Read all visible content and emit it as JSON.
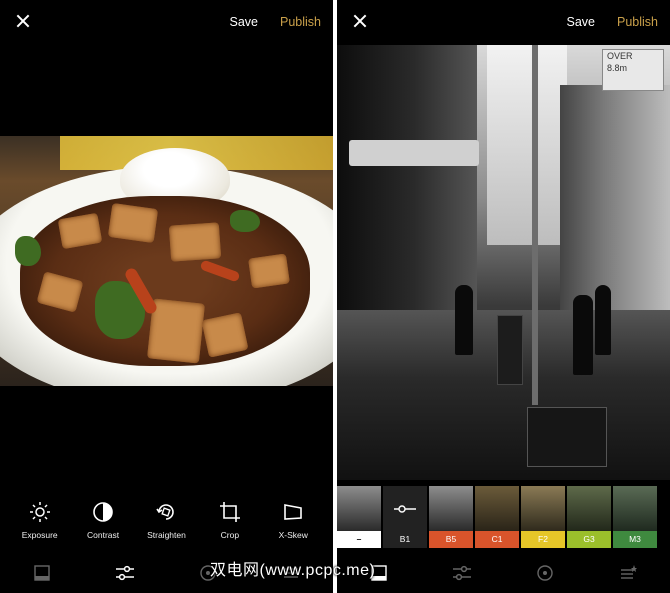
{
  "left_screen": {
    "header": {
      "save_label": "Save",
      "publish_label": "Publish"
    },
    "tools": [
      {
        "label": "Exposure",
        "icon": "sun-icon"
      },
      {
        "label": "Contrast",
        "icon": "contrast-icon"
      },
      {
        "label": "Straighten",
        "icon": "rotate-icon"
      },
      {
        "label": "Crop",
        "icon": "crop-icon"
      },
      {
        "label": "X-Skew",
        "icon": "skew-icon"
      }
    ]
  },
  "right_screen": {
    "header": {
      "save_label": "Save",
      "publish_label": "Publish"
    },
    "sign_text": {
      "line1": "OVER",
      "line2": "8.8m"
    },
    "filters": [
      {
        "label": "–",
        "color": "#ffffff",
        "text_color": "#000000"
      },
      {
        "label": "B1",
        "color": "#222222",
        "text_color": "#ffffff"
      },
      {
        "label": "B5",
        "color": "#d9542b",
        "text_color": "#ffffff"
      },
      {
        "label": "C1",
        "color": "#d9542b",
        "text_color": "#ffffff"
      },
      {
        "label": "F2",
        "color": "#e6c628",
        "text_color": "#ffffff"
      },
      {
        "label": "G3",
        "color": "#9bbf2b",
        "text_color": "#ffffff"
      },
      {
        "label": "M3",
        "color": "#3f8a3f",
        "text_color": "#ffffff"
      }
    ]
  },
  "watermark": "双电网(www.pcpc.me)",
  "colors": {
    "accent": "#c9a04a",
    "background": "#000000"
  }
}
